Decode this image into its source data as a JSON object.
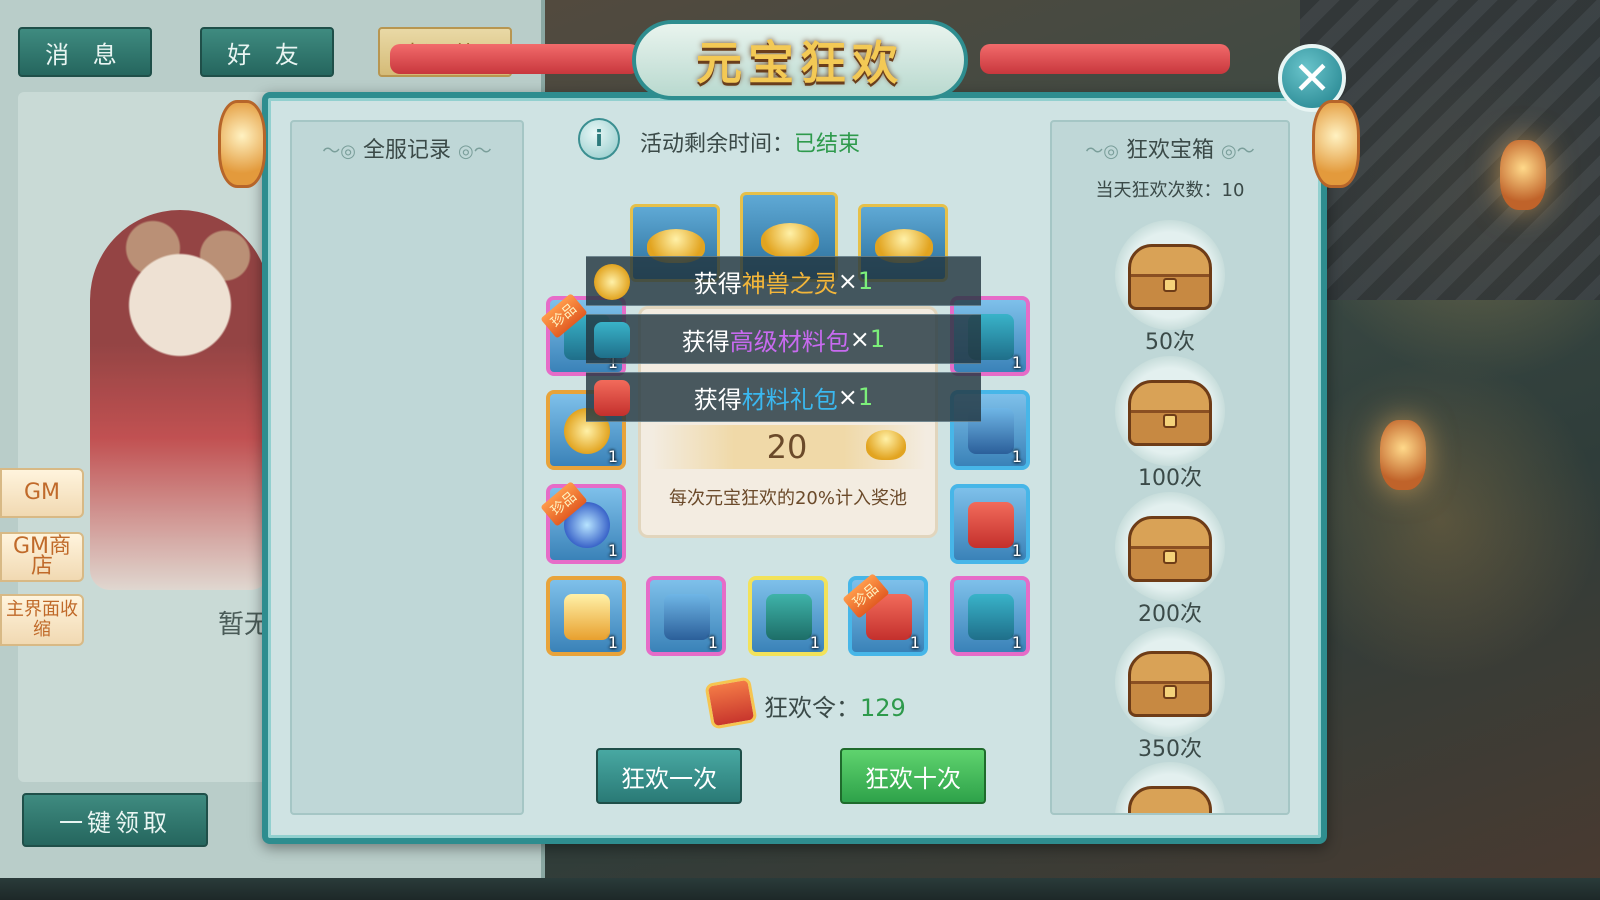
{
  "mail_panel": {
    "tabs": [
      {
        "label": "消 息"
      },
      {
        "label": "好 友"
      },
      {
        "label": "邮 件"
      }
    ],
    "empty_text": "暂无",
    "claim_all_label": "一键领取"
  },
  "side_buttons": [
    {
      "label": "GM"
    },
    {
      "label": "GM商店"
    },
    {
      "label": "主界面收缩"
    }
  ],
  "modal": {
    "title": "元宝狂欢",
    "close_glyph": "✕",
    "left_column": {
      "header": "全服记录"
    },
    "timer": {
      "label": "活动剩余时间：",
      "value": "已结束"
    },
    "pool": {
      "value": "20",
      "description": "每次元宝狂欢的20%计入奖池"
    },
    "toasts": [
      {
        "prefix": "获得",
        "item": "神兽之灵",
        "item_color": "#f3b63a",
        "times": "×",
        "count": "1"
      },
      {
        "prefix": "获得",
        "item": "高级材料包",
        "item_color": "#c86af0",
        "times": "×",
        "count": "1"
      },
      {
        "prefix": "获得",
        "item": "材料礼包",
        "item_color": "#3ab8f0",
        "times": "×",
        "count": "1"
      }
    ],
    "rewards": [
      {
        "count": "1",
        "rare_label": "珍品"
      },
      {
        "count": "1"
      },
      {
        "count": "1"
      },
      {
        "count": "1"
      },
      {
        "count": "1",
        "rare_label": "珍品"
      },
      {
        "count": "1"
      },
      {
        "count": "1"
      },
      {
        "count": "1"
      },
      {
        "count": "1"
      },
      {
        "count": "1",
        "rare_label": "珍品"
      },
      {
        "count": "1"
      }
    ],
    "token": {
      "label": "狂欢令：",
      "value": "129"
    },
    "buttons": {
      "once": "狂欢一次",
      "ten": "狂欢十次"
    },
    "right_column": {
      "header": "狂欢宝箱",
      "daily_label": "当天狂欢次数：",
      "daily_value": "10",
      "chests": [
        {
          "label": "50次"
        },
        {
          "label": "100次"
        },
        {
          "label": "200次"
        },
        {
          "label": "350次"
        }
      ]
    }
  }
}
